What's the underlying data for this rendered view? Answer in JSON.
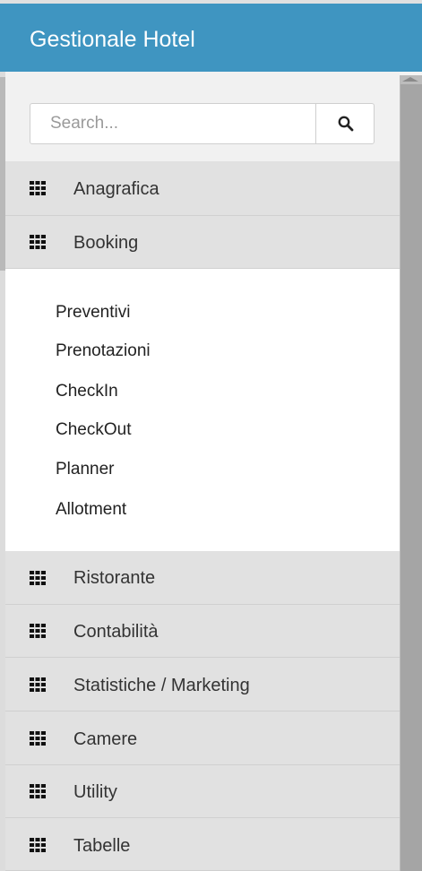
{
  "header": {
    "title": "Gestionale Hotel"
  },
  "search": {
    "placeholder": "Search..."
  },
  "menu": {
    "items": [
      {
        "label": "Anagrafica",
        "icon": "grid-icon"
      },
      {
        "label": "Booking",
        "icon": "grid-icon",
        "expanded": true
      },
      {
        "label": "Ristorante",
        "icon": "grid-icon"
      },
      {
        "label": "Contabilità",
        "icon": "grid-icon"
      },
      {
        "label": "Statistiche / Marketing",
        "icon": "grid-icon"
      },
      {
        "label": "Camere",
        "icon": "grid-icon"
      },
      {
        "label": "Utility",
        "icon": "grid-icon"
      },
      {
        "label": "Tabelle",
        "icon": "grid-icon"
      }
    ],
    "booking_submenu": [
      {
        "label": "Preventivi"
      },
      {
        "label": "Prenotazioni"
      },
      {
        "label": "CheckIn"
      },
      {
        "label": "CheckOut"
      },
      {
        "label": "Planner"
      },
      {
        "label": "Allotment"
      }
    ]
  },
  "colors": {
    "header_bg": "#3f95c1",
    "menu_item_bg": "#e1e1e1",
    "submenu_bg": "#ffffff"
  }
}
